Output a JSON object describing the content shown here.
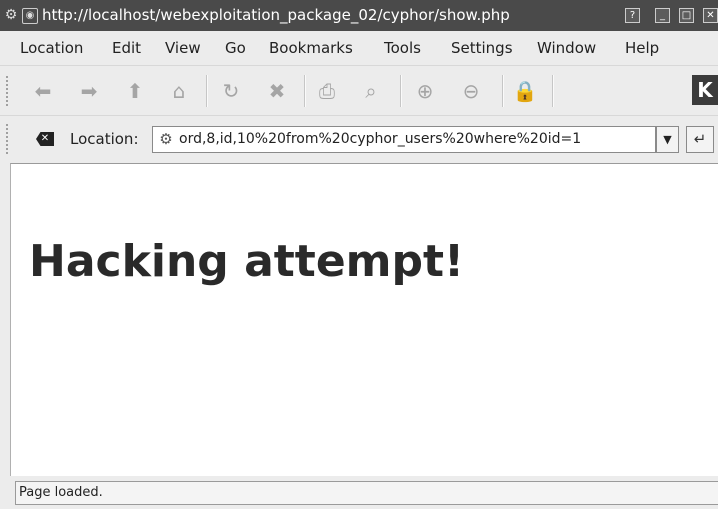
{
  "window": {
    "title": "http://localhost/webexploitation_package_02/cyphor/show.php",
    "buttons": {
      "help": "?",
      "minimize": "_",
      "maximize": "□",
      "close": "✕"
    }
  },
  "menu": {
    "items": [
      "Location",
      "Edit",
      "View",
      "Go",
      "Bookmarks",
      "Tools",
      "Settings",
      "Window",
      "Help"
    ]
  },
  "toolbar": {
    "icons": [
      "back-icon",
      "forward-icon",
      "up-icon",
      "home-icon",
      "reload-icon",
      "stop-icon",
      "print-icon",
      "find-icon",
      "zoom-in-icon",
      "zoom-out-icon",
      "security-icon"
    ],
    "logo": "K"
  },
  "location_bar": {
    "label": "Location:",
    "url_visible": "ord,8,id,10%20from%20cyphor_users%20where%20id=1"
  },
  "page": {
    "heading": "Hacking attempt!"
  },
  "status": {
    "text": "Page loaded."
  }
}
